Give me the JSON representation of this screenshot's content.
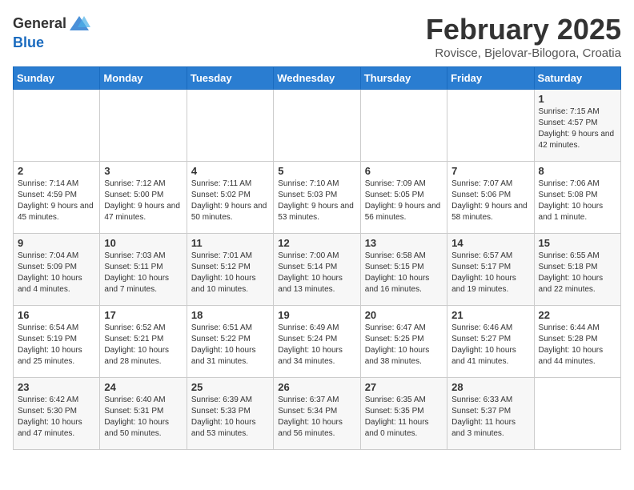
{
  "header": {
    "logo_general": "General",
    "logo_blue": "Blue",
    "month_title": "February 2025",
    "location": "Rovisce, Bjelovar-Bilogora, Croatia"
  },
  "weekdays": [
    "Sunday",
    "Monday",
    "Tuesday",
    "Wednesday",
    "Thursday",
    "Friday",
    "Saturday"
  ],
  "weeks": [
    [
      {
        "day": "",
        "info": ""
      },
      {
        "day": "",
        "info": ""
      },
      {
        "day": "",
        "info": ""
      },
      {
        "day": "",
        "info": ""
      },
      {
        "day": "",
        "info": ""
      },
      {
        "day": "",
        "info": ""
      },
      {
        "day": "1",
        "info": "Sunrise: 7:15 AM\nSunset: 4:57 PM\nDaylight: 9 hours and 42 minutes."
      }
    ],
    [
      {
        "day": "2",
        "info": "Sunrise: 7:14 AM\nSunset: 4:59 PM\nDaylight: 9 hours and 45 minutes."
      },
      {
        "day": "3",
        "info": "Sunrise: 7:12 AM\nSunset: 5:00 PM\nDaylight: 9 hours and 47 minutes."
      },
      {
        "day": "4",
        "info": "Sunrise: 7:11 AM\nSunset: 5:02 PM\nDaylight: 9 hours and 50 minutes."
      },
      {
        "day": "5",
        "info": "Sunrise: 7:10 AM\nSunset: 5:03 PM\nDaylight: 9 hours and 53 minutes."
      },
      {
        "day": "6",
        "info": "Sunrise: 7:09 AM\nSunset: 5:05 PM\nDaylight: 9 hours and 56 minutes."
      },
      {
        "day": "7",
        "info": "Sunrise: 7:07 AM\nSunset: 5:06 PM\nDaylight: 9 hours and 58 minutes."
      },
      {
        "day": "8",
        "info": "Sunrise: 7:06 AM\nSunset: 5:08 PM\nDaylight: 10 hours and 1 minute."
      }
    ],
    [
      {
        "day": "9",
        "info": "Sunrise: 7:04 AM\nSunset: 5:09 PM\nDaylight: 10 hours and 4 minutes."
      },
      {
        "day": "10",
        "info": "Sunrise: 7:03 AM\nSunset: 5:11 PM\nDaylight: 10 hours and 7 minutes."
      },
      {
        "day": "11",
        "info": "Sunrise: 7:01 AM\nSunset: 5:12 PM\nDaylight: 10 hours and 10 minutes."
      },
      {
        "day": "12",
        "info": "Sunrise: 7:00 AM\nSunset: 5:14 PM\nDaylight: 10 hours and 13 minutes."
      },
      {
        "day": "13",
        "info": "Sunrise: 6:58 AM\nSunset: 5:15 PM\nDaylight: 10 hours and 16 minutes."
      },
      {
        "day": "14",
        "info": "Sunrise: 6:57 AM\nSunset: 5:17 PM\nDaylight: 10 hours and 19 minutes."
      },
      {
        "day": "15",
        "info": "Sunrise: 6:55 AM\nSunset: 5:18 PM\nDaylight: 10 hours and 22 minutes."
      }
    ],
    [
      {
        "day": "16",
        "info": "Sunrise: 6:54 AM\nSunset: 5:19 PM\nDaylight: 10 hours and 25 minutes."
      },
      {
        "day": "17",
        "info": "Sunrise: 6:52 AM\nSunset: 5:21 PM\nDaylight: 10 hours and 28 minutes."
      },
      {
        "day": "18",
        "info": "Sunrise: 6:51 AM\nSunset: 5:22 PM\nDaylight: 10 hours and 31 minutes."
      },
      {
        "day": "19",
        "info": "Sunrise: 6:49 AM\nSunset: 5:24 PM\nDaylight: 10 hours and 34 minutes."
      },
      {
        "day": "20",
        "info": "Sunrise: 6:47 AM\nSunset: 5:25 PM\nDaylight: 10 hours and 38 minutes."
      },
      {
        "day": "21",
        "info": "Sunrise: 6:46 AM\nSunset: 5:27 PM\nDaylight: 10 hours and 41 minutes."
      },
      {
        "day": "22",
        "info": "Sunrise: 6:44 AM\nSunset: 5:28 PM\nDaylight: 10 hours and 44 minutes."
      }
    ],
    [
      {
        "day": "23",
        "info": "Sunrise: 6:42 AM\nSunset: 5:30 PM\nDaylight: 10 hours and 47 minutes."
      },
      {
        "day": "24",
        "info": "Sunrise: 6:40 AM\nSunset: 5:31 PM\nDaylight: 10 hours and 50 minutes."
      },
      {
        "day": "25",
        "info": "Sunrise: 6:39 AM\nSunset: 5:33 PM\nDaylight: 10 hours and 53 minutes."
      },
      {
        "day": "26",
        "info": "Sunrise: 6:37 AM\nSunset: 5:34 PM\nDaylight: 10 hours and 56 minutes."
      },
      {
        "day": "27",
        "info": "Sunrise: 6:35 AM\nSunset: 5:35 PM\nDaylight: 11 hours and 0 minutes."
      },
      {
        "day": "28",
        "info": "Sunrise: 6:33 AM\nSunset: 5:37 PM\nDaylight: 11 hours and 3 minutes."
      },
      {
        "day": "",
        "info": ""
      }
    ]
  ]
}
